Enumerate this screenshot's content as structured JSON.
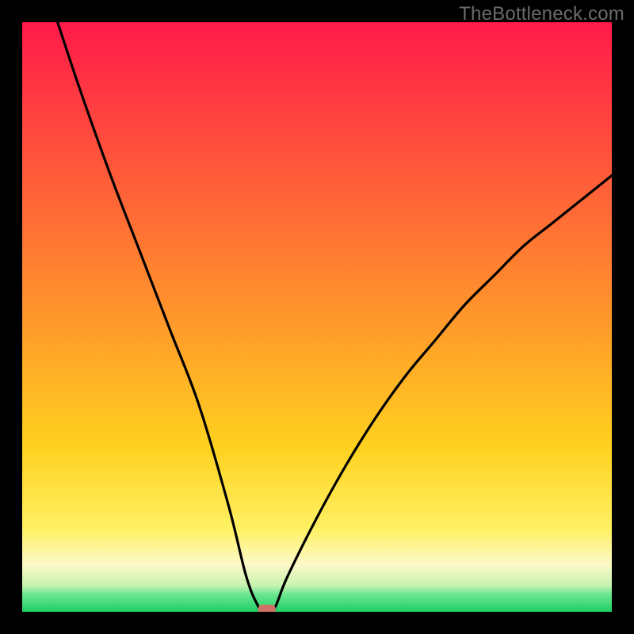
{
  "watermark": "TheBottleneck.com",
  "colors": {
    "gradient": {
      "c0": "#ff1a49",
      "c1": "#ff8a2e",
      "c2": "#ffd11f",
      "c3": "#fff164",
      "c4": "#fcf9c8",
      "c5": "#c8f3b1",
      "c6": "#6de691",
      "c7": "#1fcf65"
    },
    "curve_stroke": "#000000",
    "marker_fill": "#cf7166",
    "frame_bg": "#000000"
  },
  "chart_data": {
    "type": "line",
    "title": "",
    "xlabel": "",
    "ylabel": "",
    "xlim": [
      0,
      100
    ],
    "ylim": [
      0,
      100
    ],
    "series": [
      {
        "name": "bottleneck-curve",
        "x": [
          6,
          10,
          15,
          20,
          25,
          30,
          35,
          38,
          40,
          41,
          42,
          43,
          45,
          50,
          55,
          60,
          65,
          70,
          75,
          80,
          85,
          90,
          95,
          100
        ],
        "y": [
          100,
          88,
          74,
          61,
          48,
          35,
          18,
          6,
          1,
          0,
          0,
          1,
          6,
          16,
          25,
          33,
          40,
          46,
          52,
          57,
          62,
          66,
          70,
          74
        ]
      }
    ],
    "minimum_point": {
      "x": 41.5,
      "y": 0
    },
    "annotations": []
  }
}
